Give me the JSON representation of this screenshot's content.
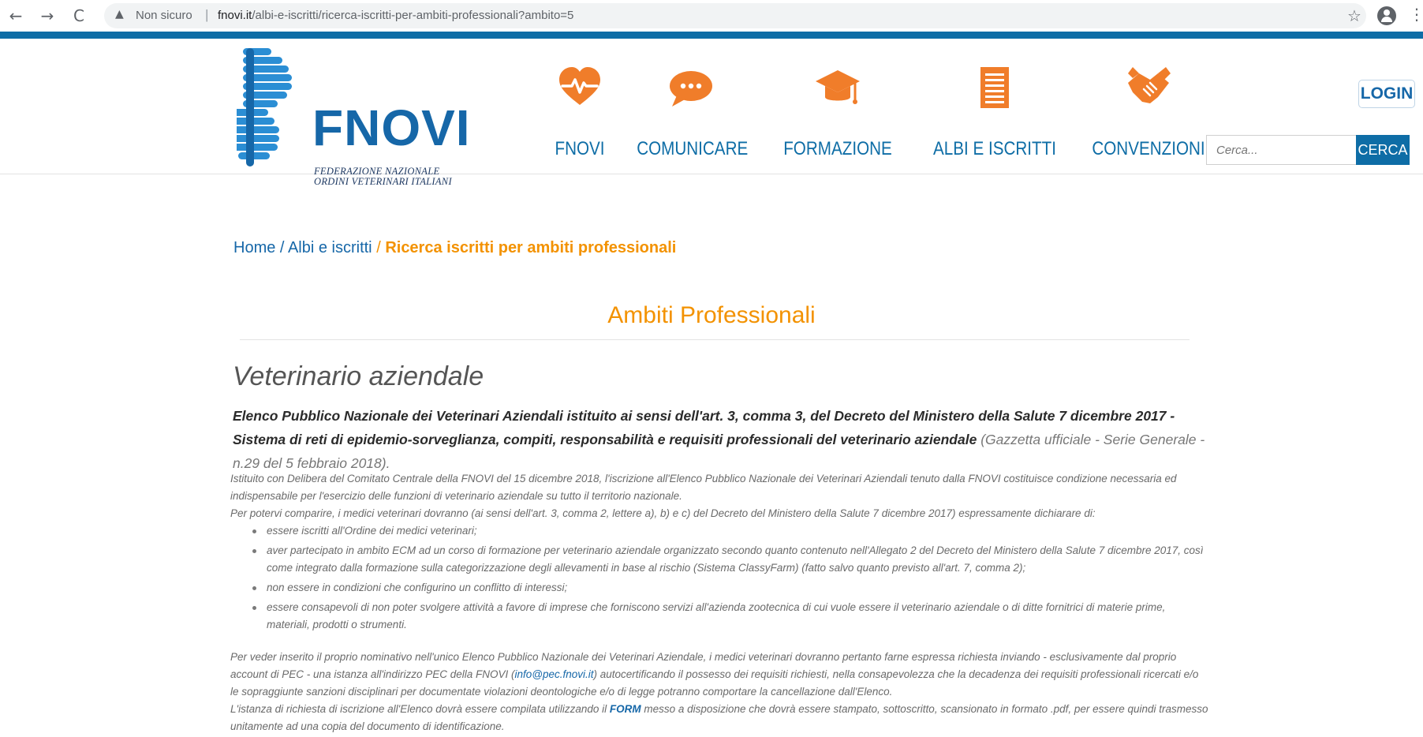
{
  "browser": {
    "back_icon": "←",
    "forward_icon": "→",
    "reload_icon": "C",
    "warn_icon": "▲",
    "not_secure": "Non sicuro",
    "separator": "|",
    "url_domain": "fnovi.it",
    "url_path": "/albi-e-iscritti/ricerca-iscritti-per-ambiti-professionali?ambito=5",
    "star_icon": "☆",
    "menu_icon": "⋮"
  },
  "header": {
    "logo_title": "FNOVI",
    "logo_sub1": "FEDERAZIONE NAZIONALE",
    "logo_sub2": "ORDINI VETERINARI ITALIANI",
    "nav": [
      {
        "label": "FNOVI",
        "icon": "heart-pulse-icon"
      },
      {
        "label": "COMUNICARE",
        "icon": "speech-bubble-icon"
      },
      {
        "label": "FORMAZIONE",
        "icon": "graduation-cap-icon"
      },
      {
        "label": "ALBI E ISCRITTI",
        "icon": "document-list-icon"
      },
      {
        "label": "CONVENZIONI",
        "icon": "handshake-icon"
      }
    ],
    "login_label": "LOGIN",
    "search_placeholder": "Cerca...",
    "search_button": "CERCA"
  },
  "breadcrumb": {
    "home": "Home",
    "albi": "Albi e iscritti",
    "current": "Ricerca iscritti per ambiti professionali",
    "sep": " / "
  },
  "main": {
    "section_title": "Ambiti Professionali",
    "heading": "Veterinario aziendale",
    "lead_bold": "Elenco Pubblico Nazionale dei Veterinari Aziendali istituito ai sensi dell'art. 3, comma 3, del Decreto del Ministero della Salute 7 dicembre 2017 - Sistema di reti di epidemio-sorveglianza, compiti, responsabilità e requisiti professionali del veterinario aziendale",
    "lead_ref": " (Gazzetta ufficiale - Serie Generale - n.29 del 5 febbraio 2018).",
    "para1": "Istituito con Delibera del Comitato Centrale della FNOVI del 15 dicembre 2018, l'iscrizione all'Elenco Pubblico Nazionale dei Veterinari Aziendali tenuto dalla FNOVI costituisce condizione necessaria ed indispensabile per l'esercizio delle funzioni di veterinario aziendale su tutto il territorio nazionale.",
    "para1b": "Per potervi comparire, i medici veterinari dovranno (ai sensi dell'art. 3, comma 2, lettere a), b) e c) del Decreto del Ministero della Salute 7 dicembre 2017) espressamente dichiarare di:",
    "list": [
      "essere iscritti all'Ordine dei medici veterinari;",
      "aver partecipato in ambito ECM ad un corso di formazione per veterinario aziendale organizzato secondo quanto contenuto nell'Allegato 2 del Decreto del Ministero della Salute 7 dicembre 2017, così come integrato dalla formazione sulla categorizzazione degli allevamenti in base al rischio (Sistema ClassyFarm)  (fatto salvo quanto previsto all'art. 7, comma 2);",
      "non essere in condizioni che configurino un conflitto di interessi;",
      "essere consapevoli di non poter svolgere attività a favore di imprese che forniscono servizi all'azienda zootecnica di cui vuole essere il veterinario aziendale o di ditte fornitrici di materie prime, materiali, prodotti o strumenti."
    ],
    "para2_a": "Per veder inserito il proprio nominativo nell'unico Elenco Pubblico Nazionale dei Veterinari Aziendale, i medici veterinari dovranno pertanto farne espressa richiesta inviando - esclusivamente dal proprio account di PEC - una istanza all'indirizzo PEC della FNOVI (",
    "pec_email": "info@pec.fnovi.it",
    "para2_b": ") autocertificando il possesso dei requisiti richiesti, nella consapevolezza che la decadenza dei requisiti professionali ricercati e/o le sopraggiunte sanzioni disciplinari per documentate violazioni deontologiche e/o di legge potranno comportare la cancellazione dall'Elenco.",
    "para3_a": "L'istanza di richiesta di iscrizione all'Elenco dovrà essere compilata utilizzando il ",
    "form_link": "FORM",
    "para3_b": " messo a disposizione che dovrà essere stampato, sottoscritto, scansionato in formato .pdf, per essere quindi trasmesso unitamente ad una copia del documento di identificazione."
  },
  "colors": {
    "brand_blue": "#0e6da6",
    "accent_orange": "#f39200",
    "icon_orange": "#f07d2a"
  }
}
